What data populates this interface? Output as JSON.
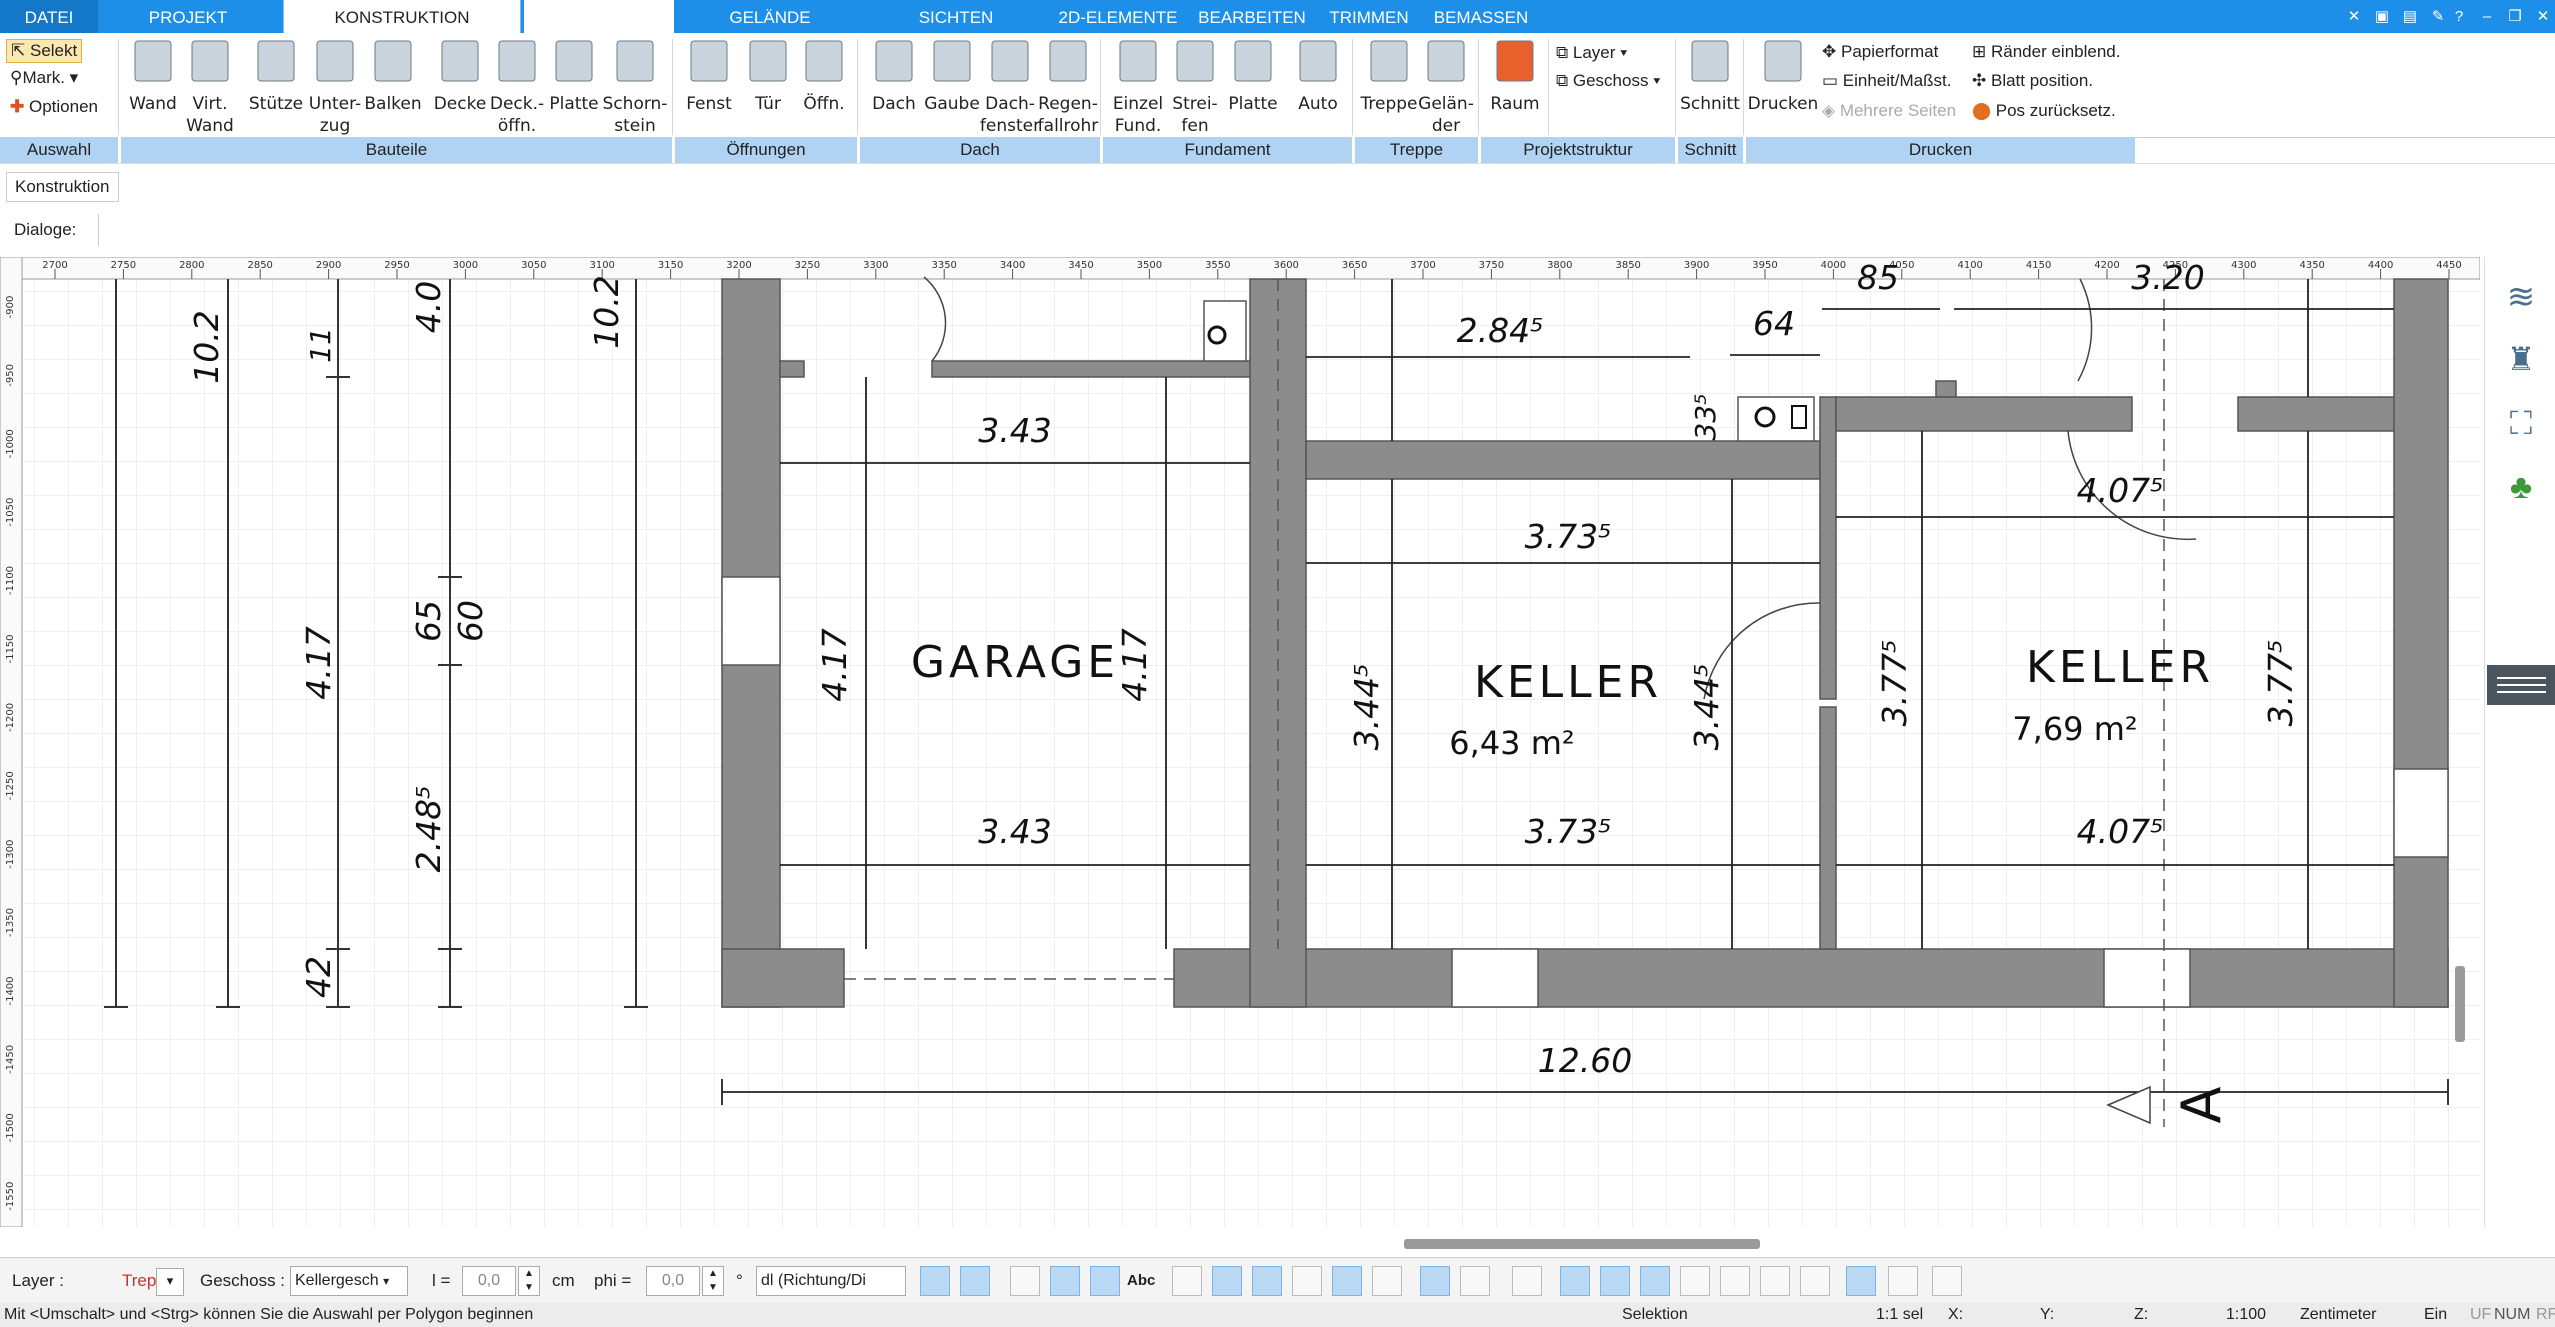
{
  "tabs": [
    {
      "label": "DATEI"
    },
    {
      "label": "PROJEKT"
    },
    {
      "label": "KONSTRUKTION"
    },
    {
      "label": ""
    },
    {
      "label": "GELÄNDE"
    },
    {
      "label": "SICHTEN"
    },
    {
      "label": "2D-ELEMENTE"
    },
    {
      "label": "BEARBEITEN"
    },
    {
      "label": "TRIMMEN"
    },
    {
      "label": "BEMASSEN"
    }
  ],
  "auswahl": {
    "selekt": "Selekt",
    "mark": "Mark.",
    "optionen": "Optionen"
  },
  "ribbon_buttons": [
    {
      "label": "Wand",
      "label2": "",
      "icon": "wall-icon"
    },
    {
      "label": "Virt.",
      "label2": "Wand",
      "icon": "virtual-wall-icon"
    },
    {
      "label": "Stütze",
      "label2": "",
      "icon": "column-icon"
    },
    {
      "label": "Unter-",
      "label2": "zug",
      "icon": "beam-under-icon"
    },
    {
      "label": "Balken",
      "label2": "",
      "icon": "beam-icon"
    },
    {
      "label": "Decke",
      "label2": "",
      "icon": "ceiling-icon"
    },
    {
      "label": "Deck.-",
      "label2": "öffn.",
      "icon": "ceiling-opening-icon"
    },
    {
      "label": "Platte",
      "label2": "",
      "icon": "slab-icon"
    },
    {
      "label": "Schorn-",
      "label2": "stein",
      "icon": "chimney-icon"
    },
    {
      "label": "Fenst",
      "label2": "",
      "icon": "window-icon"
    },
    {
      "label": "Tür",
      "label2": "",
      "icon": "door-icon"
    },
    {
      "label": "Öffn.",
      "label2": "",
      "icon": "opening-icon"
    },
    {
      "label": "Dach",
      "label2": "",
      "icon": "roof-icon"
    },
    {
      "label": "Gaube",
      "label2": "",
      "icon": "dormer-icon"
    },
    {
      "label": "Dach-",
      "label2": "fenster",
      "icon": "roof-window-icon"
    },
    {
      "label": "Regen-",
      "label2": "fallrohr",
      "icon": "downpipe-icon"
    },
    {
      "label": "Einzel",
      "label2": "Fund.",
      "icon": "single-foundation-icon"
    },
    {
      "label": "Strei-",
      "label2": "fen",
      "icon": "strip-foundation-icon"
    },
    {
      "label": "Platte",
      "label2": "",
      "icon": "foundation-slab-icon"
    },
    {
      "label": "Auto",
      "label2": "",
      "icon": "auto-icon"
    },
    {
      "label": "Treppe",
      "label2": "",
      "icon": "stairs-icon"
    },
    {
      "label": "Gelän-",
      "label2": "der",
      "icon": "railing-icon"
    },
    {
      "label": "Raum",
      "label2": "",
      "icon": "room-icon"
    },
    {
      "label": "Schnitt",
      "label2": "",
      "icon": "section-icon"
    },
    {
      "label": "Drucken",
      "label2": "",
      "icon": "printer-icon"
    }
  ],
  "projektstruktur": {
    "layer": "Layer",
    "geschoss": "Geschoss"
  },
  "drucken_small": {
    "papierformat": "Papierformat",
    "einheit": "Einheit/Maßst.",
    "mehrere": "Mehrere Seiten",
    "raender": "Ränder einblend.",
    "blatt": "Blatt position.",
    "pos": "Pos zurücksetz."
  },
  "groups": [
    "Auswahl",
    "Bauteile",
    "Öffnungen",
    "Dach",
    "Fundament",
    "Treppe",
    "Projektstruktur",
    "Schnitt",
    "Drucken"
  ],
  "panel": {
    "konstruktion": "Konstruktion",
    "dialoge": "Dialoge:"
  },
  "ruler": {
    "top": [
      "2700",
      "2750",
      "2800",
      "2850",
      "2900",
      "2950",
      "3000",
      "3050",
      "3100",
      "3150",
      "3200",
      "3250",
      "3300",
      "3350",
      "3400",
      "3450",
      "3500",
      "3550",
      "3600",
      "3650",
      "3700",
      "3750",
      "3800",
      "3850",
      "3900",
      "3950",
      "4000",
      "4050",
      "4100",
      "4150",
      "4200",
      "4250",
      "4300",
      "4350",
      "4400",
      "4450"
    ],
    "left": [
      "-900",
      "-950",
      "-1000",
      "-1050",
      "-1100",
      "-1150",
      "-1200",
      "-1250",
      "-1300",
      "-1350",
      "-1400",
      "-1450",
      "-1500",
      "-1550"
    ]
  },
  "plan": {
    "rooms": [
      {
        "name": "GARAGE",
        "area": ""
      },
      {
        "name": "KELLER",
        "area": "6,43 m²"
      },
      {
        "name": "KELLER",
        "area": "7,69 m²"
      }
    ],
    "dims": {
      "left_a": "10.2",
      "left_b": "4.0",
      "left_c": "10.2",
      "d11": "11",
      "d417a": "4.17",
      "d65": "65",
      "d60": "60",
      "d2485": "2.48⁵",
      "d42": "42",
      "g343_top": "3.43",
      "g343_bot": "3.43",
      "g417_l": "4.17",
      "g417_r": "4.17",
      "k2845": "2.84⁵",
      "k64": "64",
      "k335": "33⁵",
      "k3735_top": "3.73⁵",
      "k3735_bot": "3.73⁵",
      "k3445_l": "3.44⁵",
      "k3445_r": "3.44⁵",
      "k85": "85",
      "k320": "3.20",
      "k4075_top": "4.07⁵",
      "k4075_bot": "4.07⁵",
      "k3775_l": "3.77⁵",
      "k3775_r": "3.77⁵",
      "total": "12.60",
      "section": "A"
    }
  },
  "bottombar": {
    "layer_label": "Layer :",
    "layer_value": "Treppen",
    "geschoss_label": "Geschoss :",
    "geschoss_value": "Kellergesch",
    "l_label": "l =",
    "l_value": "0,0",
    "l_unit": "cm",
    "phi_label": "phi =",
    "phi_value": "0,0",
    "phi_unit": "°",
    "dl_value": "dl (Richtung/Di",
    "abc": "Abc"
  },
  "status": {
    "hint": "Mit <Umschalt> und <Strg> können Sie die Auswahl per Polygon beginnen",
    "mode": "Selektion",
    "sel": "1:1 sel",
    "x": "X:",
    "y": "Y:",
    "z": "Z:",
    "scale": "1:100",
    "unit": "Zentimeter",
    "ein": "Ein",
    "uf": "UF",
    "num": "NUM",
    "rf": "RF"
  },
  "colors": {
    "accent": "#1e8fe8",
    "groupbar": "#b0d3f3",
    "wall": "#8c8c8c",
    "layer_value": "#d03030"
  }
}
